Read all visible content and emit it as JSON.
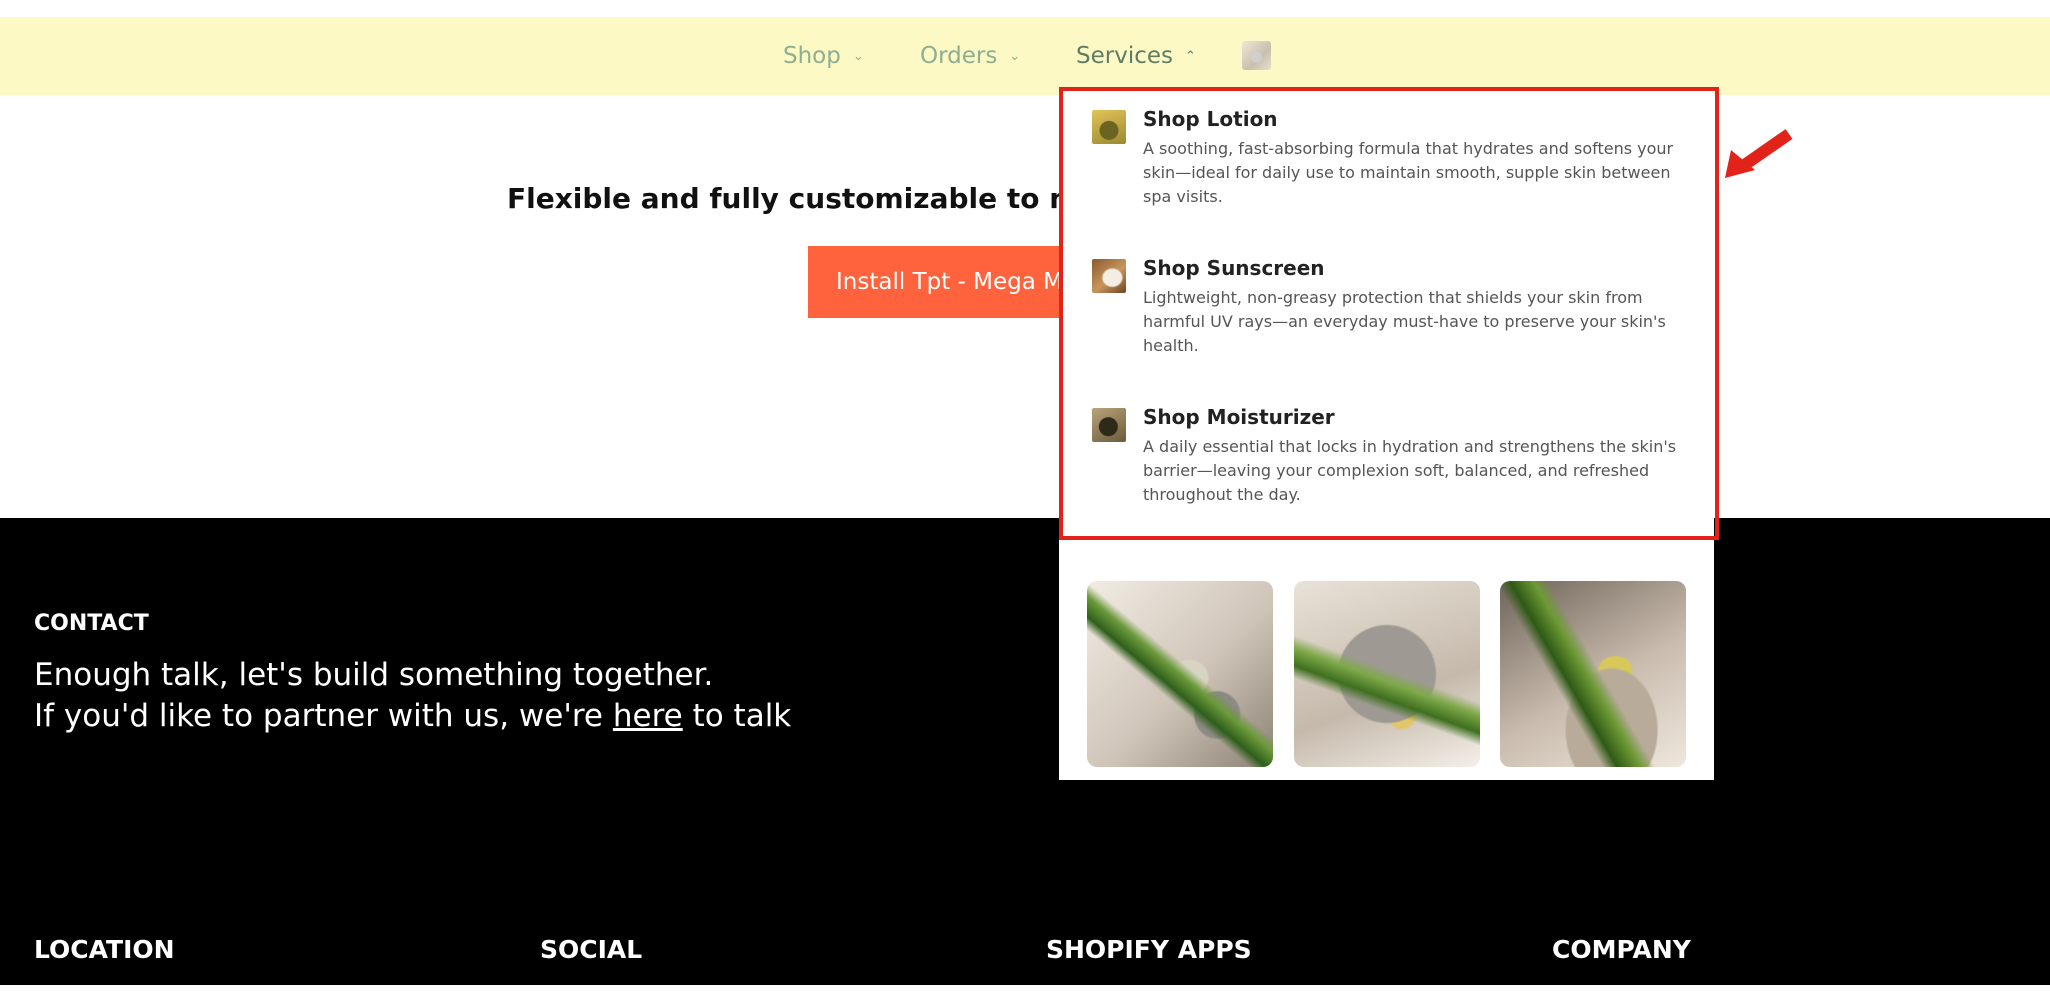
{
  "nav": {
    "items": [
      {
        "label": "Shop",
        "chevron": "⌄"
      },
      {
        "label": "Orders",
        "chevron": "⌄"
      },
      {
        "label": "Services",
        "chevron": "⌃"
      }
    ],
    "active": "Services",
    "thumbnail_icon": "spa-product-thumbnail"
  },
  "hero": {
    "heading": "Flexible and fully customizable to match",
    "button_label": "Install Tpt - Mega Menu"
  },
  "mega_menu": {
    "items": [
      {
        "title": "Shop Lotion",
        "description": "A soothing, fast-absorbing formula that hydrates and softens your skin—ideal for daily use to maintain smooth, supple skin between spa visits."
      },
      {
        "title": "Shop Sunscreen",
        "description": "Lightweight, non-greasy protection that shields your skin from harmful UV rays—an everyday must-have to preserve your skin's health."
      },
      {
        "title": "Shop Moisturizer",
        "description": "A daily essential that locks in hydration and strengthens the skin's barrier—leaving your complexion soft, balanced, and refreshed throughout the day."
      }
    ],
    "images": [
      "serum-bottle-leaf-image",
      "serum-bottle-mirror-image",
      "serum-dropper-bottle-image"
    ]
  },
  "footer": {
    "contact_heading": "CONTACT",
    "contact_line1": "Enough talk, let's build something together.",
    "contact_line2_before": "If you'd like to partner with us, we're ",
    "contact_link": "here",
    "contact_line2_after": " to talk",
    "columns": [
      "LOCATION",
      "SOCIAL",
      "SHOPIFY APPS",
      "COMPANY"
    ]
  },
  "colors": {
    "nav_background": "#fcf9c5",
    "nav_text": "#8eae91",
    "nav_active_text": "#5f7c64",
    "button_background": "#fe633d",
    "footer_background": "#000000",
    "highlight": "#e2231a"
  }
}
